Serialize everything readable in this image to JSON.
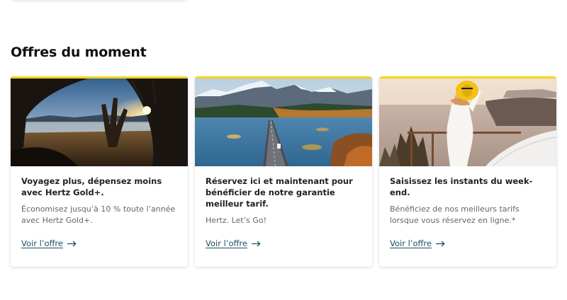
{
  "section": {
    "title": "Offres du moment"
  },
  "colors": {
    "accent": "#f7d417",
    "link": "#1b4f63"
  },
  "offers": [
    {
      "image": "sunset-road-trip-hand-from-car",
      "title": "Voyagez plus, dépensez moins avec Hertz Gold+.",
      "description": "Économisez jusqu’à 10 % toute l’année avec Hertz Gold+.",
      "link_label": "Voir l’offre",
      "link_icon": "arrow-right-icon"
    },
    {
      "image": "mountain-lake-bridge-road",
      "title": "Réservez ici et maintenant pour bénéficier de notre garantie meilleur tarif.",
      "description": "Hertz. Let’s Go!",
      "link_label": "Voir l’offre",
      "link_icon": "arrow-right-icon"
    },
    {
      "image": "woman-yellow-hat-coast",
      "title": "Saisissez les instants du week-end.",
      "description": "Bénéficiez de nos meilleurs tarifs lorsque vous réservez en ligne.*",
      "link_label": "Voir l’offre",
      "link_icon": "arrow-right-icon"
    }
  ]
}
